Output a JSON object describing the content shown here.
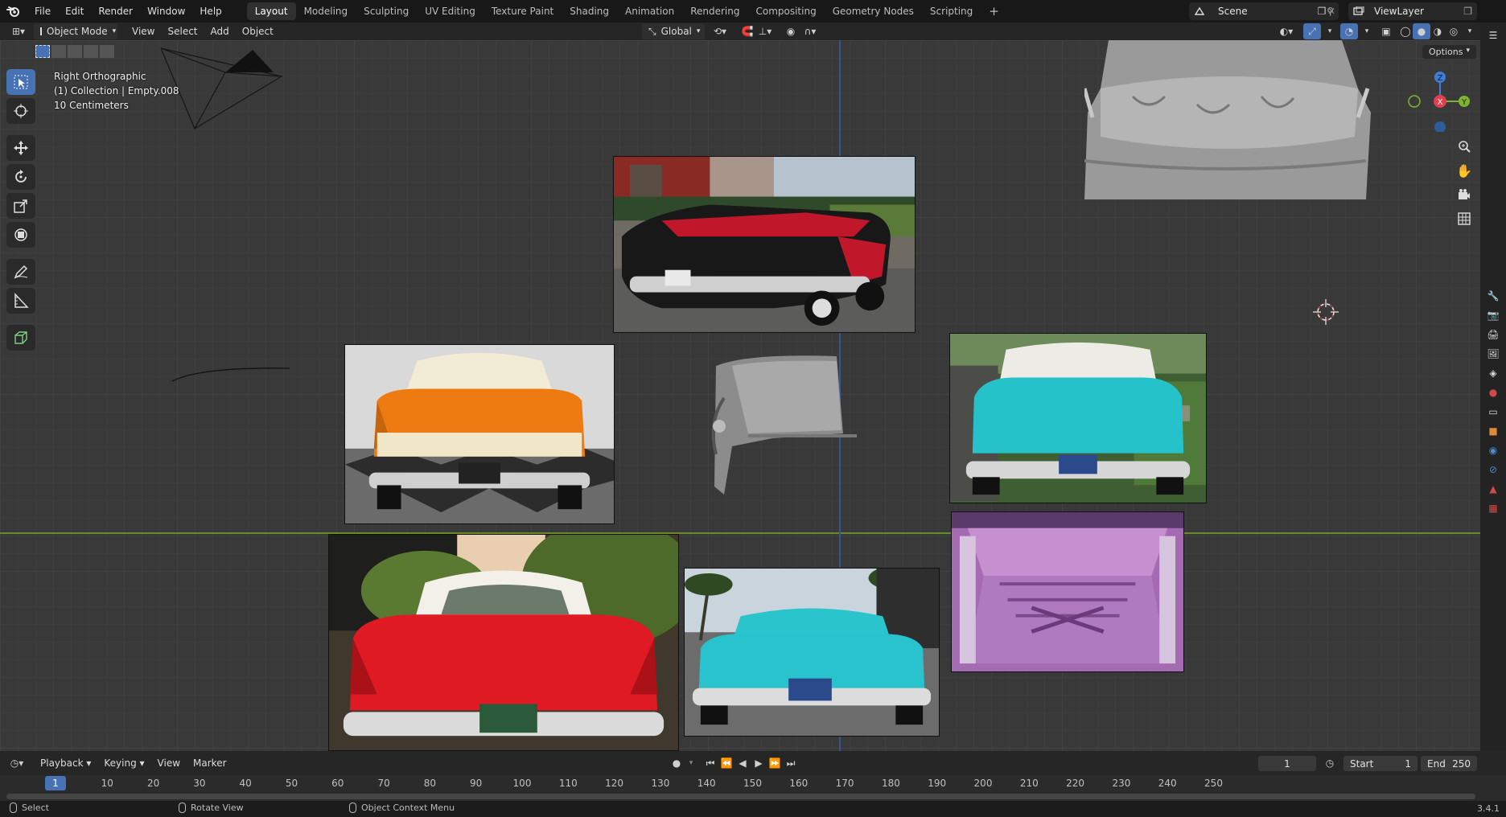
{
  "menu": {
    "items": [
      "File",
      "Edit",
      "Render",
      "Window",
      "Help"
    ]
  },
  "workspaces": {
    "tabs": [
      "Layout",
      "Modeling",
      "Sculpting",
      "UV Editing",
      "Texture Paint",
      "Shading",
      "Animation",
      "Rendering",
      "Compositing",
      "Geometry Nodes",
      "Scripting"
    ],
    "active": "Layout",
    "add_label": "+"
  },
  "scene": {
    "name": "Scene",
    "view_layer": "ViewLayer"
  },
  "header": {
    "mode": "Object Mode",
    "menus": [
      "View",
      "Select",
      "Add",
      "Object"
    ],
    "transform_orientation": "Global",
    "options_label": "Options"
  },
  "viewport": {
    "view_name": "Right Orthographic",
    "collection_info": "(1) Collection | Empty.008",
    "scale_info": "10 Centimeters"
  },
  "gizmo": {
    "x": "X",
    "y": "Y",
    "z": "Z"
  },
  "colors": {
    "accent": "#4772b3",
    "axis_x": "#e0404c",
    "axis_y": "#7fb52c",
    "axis_z": "#3d7fd6"
  },
  "timeline": {
    "menus": [
      "Playback",
      "Keying",
      "View",
      "Marker"
    ],
    "current_frame": "1",
    "start_label": "Start",
    "start_value": "1",
    "end_label": "End",
    "end_value": "250",
    "ticks": [
      "10",
      "20",
      "30",
      "40",
      "50",
      "60",
      "70",
      "80",
      "90",
      "100",
      "110",
      "120",
      "130",
      "140",
      "150",
      "160",
      "170",
      "180",
      "190",
      "200",
      "210",
      "220",
      "230",
      "240",
      "250"
    ]
  },
  "status": {
    "select": "Select",
    "rotate": "Rotate View",
    "context": "Object Context Menu",
    "version": "3.4.1"
  }
}
